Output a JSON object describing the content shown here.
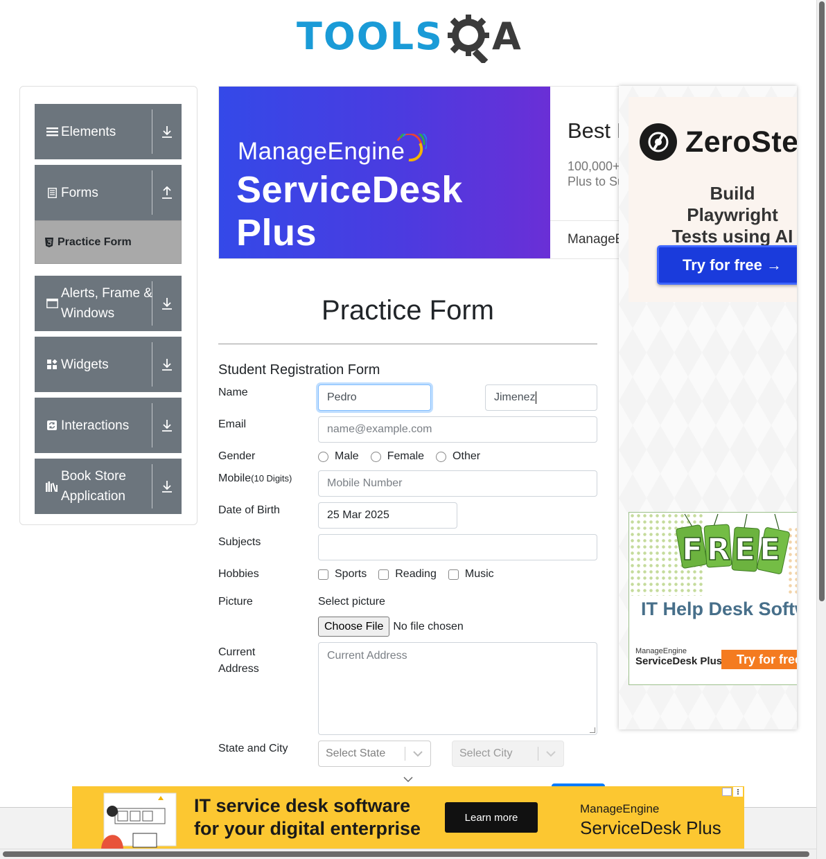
{
  "logo": {
    "tools": "TOOLS",
    "q": "Q",
    "a": "A"
  },
  "sidebar": {
    "groups": [
      {
        "label": "Elements",
        "icon": "menu-icon",
        "arrow": "download-arrow-icon"
      },
      {
        "label": "Forms",
        "icon": "document-icon",
        "arrow": "upload-arrow-icon"
      },
      {
        "label": "Alerts, Frame & Windows",
        "icon": "window-icon",
        "arrow": "download-arrow-icon"
      },
      {
        "label": "Widgets",
        "icon": "widgets-icon",
        "arrow": "download-arrow-icon"
      },
      {
        "label": "Interactions",
        "icon": "interactions-icon",
        "arrow": "download-arrow-icon"
      },
      {
        "label": "Book Store Application",
        "icon": "books-icon",
        "arrow": "download-arrow-icon"
      }
    ],
    "active_item": {
      "label": "Practice Form",
      "icon": "html5-icon"
    }
  },
  "top_ad": {
    "brand_small": "ManageEngine",
    "brand_big": "ServiceDesk Plus",
    "headline": "Best I",
    "desc_line1": "100,000+",
    "desc_line2": "Plus to Su",
    "footer": "ManageE"
  },
  "right_ad": {
    "zerostep_name": "ZeroStep",
    "zerostep_tag_line1": "Build Playwright",
    "zerostep_tag_line2": "Tests using AI",
    "zerostep_button": "Try for free →",
    "free_text": "FREE",
    "help_desk": "IT Help Desk Software",
    "me_small": "ManageEngine",
    "me_product": "ServiceDesk Plus",
    "try_button": "Try for free"
  },
  "form": {
    "page_title": "Practice Form",
    "heading": "Student Registration Form",
    "name_label": "Name",
    "first_name_value": "Pedro",
    "last_name_value": "Jimenez",
    "email_label": "Email",
    "email_placeholder": "name@example.com",
    "gender_label": "Gender",
    "gender_options": [
      "Male",
      "Female",
      "Other"
    ],
    "mobile_label": "Mobile",
    "mobile_hint": "(10 Digits)",
    "mobile_placeholder": "Mobile Number",
    "dob_label": "Date of Birth",
    "dob_value": "25 Mar 2025",
    "subjects_label": "Subjects",
    "hobbies_label": "Hobbies",
    "hobby_options": [
      "Sports",
      "Reading",
      "Music"
    ],
    "picture_label": "Picture",
    "select_picture": "Select picture",
    "choose_file": "Choose File",
    "no_file": "No file chosen",
    "address_label_line1": "Current",
    "address_label_line2": "Address",
    "address_placeholder": "Current Address",
    "state_city_label": "State and City",
    "state_placeholder": "Select State",
    "city_placeholder": "Select City"
  },
  "bottom_ad": {
    "line1": "IT service desk software",
    "line2": "for your digital enterprise",
    "cta": "Learn more",
    "brand_small": "ManageEngine",
    "brand_product": "ServiceDesk Plus"
  },
  "colors": {
    "logo_blue": "#1a9bd7",
    "sidebar_gray": "#6c757d",
    "active_gray": "#a9a9a9",
    "ad_yellow": "#fcc731",
    "zerostep_blue": "#1a3bdc"
  }
}
